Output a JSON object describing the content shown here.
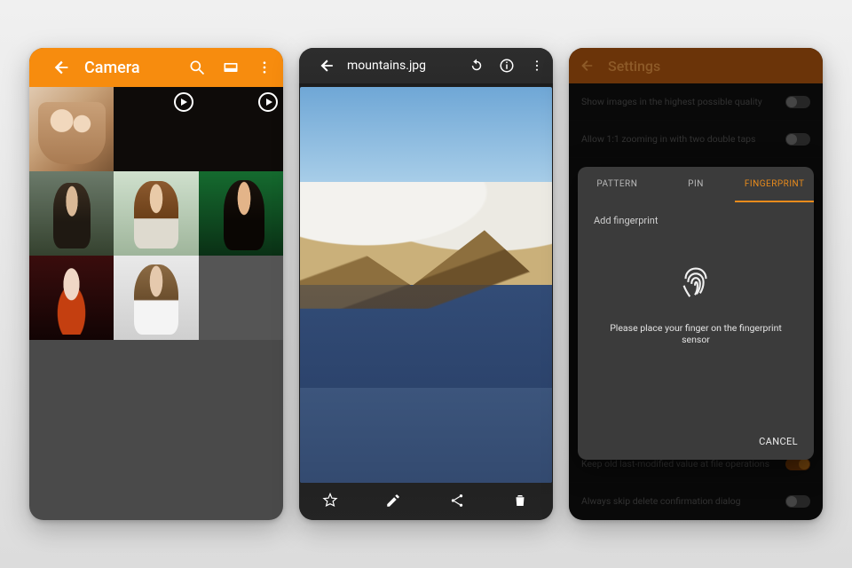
{
  "screen1": {
    "title": "Camera",
    "thumbs": [
      {
        "kind": "photo"
      },
      {
        "kind": "video"
      },
      {
        "kind": "video"
      },
      {
        "kind": "photo"
      },
      {
        "kind": "photo"
      },
      {
        "kind": "photo"
      },
      {
        "kind": "photo"
      },
      {
        "kind": "photo"
      }
    ]
  },
  "screen2": {
    "filename": "mountains.jpg"
  },
  "screen3": {
    "title": "Settings",
    "rows": {
      "quality": "Show images in the highest possible quality",
      "zoom": "Allow 1:1 zooming in with two double taps",
      "keep_modified": "Keep old last-modified value at file operations",
      "skip_delete": "Always skip delete confirmation dialog"
    },
    "tabs": {
      "pattern": "PATTERN",
      "pin": "PIN",
      "fingerprint": "FINGERPRINT"
    },
    "sheet": {
      "subtitle": "Add fingerprint",
      "hint": "Please place your finger on the fingerprint sensor",
      "cancel": "CANCEL"
    },
    "toggles": {
      "quality": false,
      "zoom": false,
      "keep_modified": true,
      "skip_delete": false
    }
  },
  "colors": {
    "accent": "#f78c0e",
    "accent_dark": "#e88b1c"
  }
}
